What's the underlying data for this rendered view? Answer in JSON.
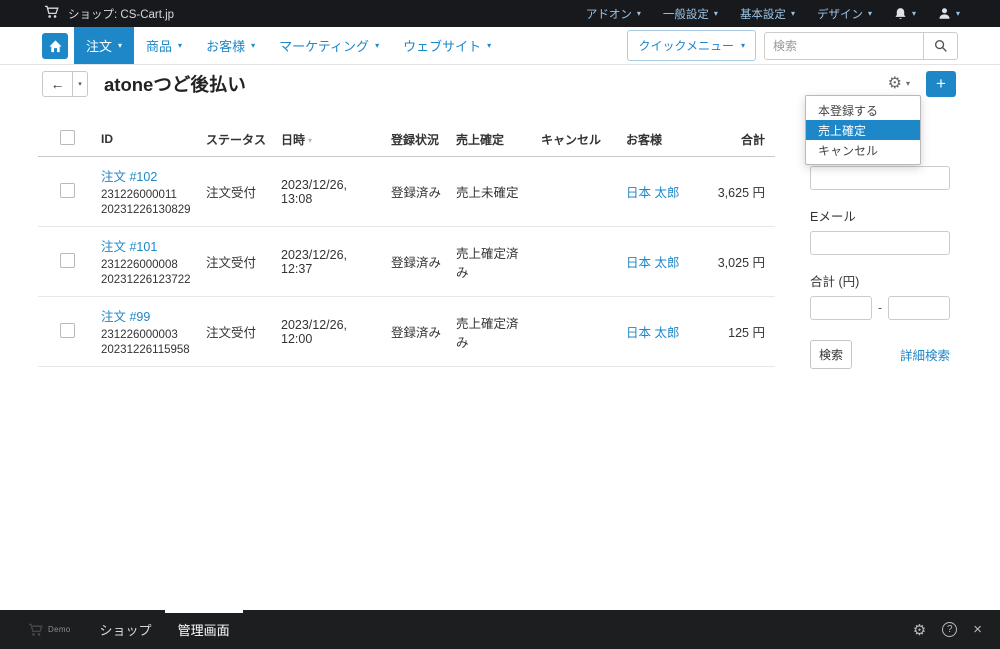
{
  "topbar": {
    "shop_label": "ショップ: CS-Cart.jp",
    "menus": [
      {
        "label": "アドオン"
      },
      {
        "label": "一般設定"
      },
      {
        "label": "基本設定"
      },
      {
        "label": "デザイン"
      }
    ]
  },
  "navbar": {
    "tabs": [
      {
        "label": "注文"
      },
      {
        "label": "商品"
      },
      {
        "label": "お客様"
      },
      {
        "label": "マーケティング"
      },
      {
        "label": "ウェブサイト"
      }
    ],
    "quick_menu_label": "クイックメニュー",
    "search_placeholder": "検索"
  },
  "header": {
    "title": "atoneつど後払い"
  },
  "gear_menu": {
    "items": [
      {
        "label": "本登録する"
      },
      {
        "label": "売上確定"
      },
      {
        "label": "キャンセル"
      }
    ]
  },
  "table": {
    "columns": [
      "ID",
      "ステータス",
      "日時",
      "登録状況",
      "売上確定",
      "キャンセル",
      "お客様",
      "合計"
    ],
    "rows": [
      {
        "order": "注文 #102",
        "id_line1": "231226000011",
        "id_line2": "20231226130829",
        "status": "注文受付",
        "datetime": "2023/12/26, 13:08",
        "registration": "登録済み",
        "sales": "売上未確定",
        "cancel": "",
        "customer": "日本 太郎",
        "total": "3,625 円"
      },
      {
        "order": "注文 #101",
        "id_line1": "231226000008",
        "id_line2": "20231226123722",
        "status": "注文受付",
        "datetime": "2023/12/26, 12:37",
        "registration": "登録済み",
        "sales": "売上確定済み",
        "cancel": "",
        "customer": "日本 太郎",
        "total": "3,025 円"
      },
      {
        "order": "注文 #99",
        "id_line1": "231226000003",
        "id_line2": "20231226115958",
        "status": "注文受付",
        "datetime": "2023/12/26, 12:00",
        "registration": "登録済み",
        "sales": "売上確定済み",
        "cancel": "",
        "customer": "日本 太郎",
        "total": "125 円"
      }
    ]
  },
  "sidebar": {
    "email_label": "Eメール",
    "total_label": "合計 (円)",
    "search_button": "検索",
    "advanced_search_link": "詳細検索"
  },
  "bottombar": {
    "demo_badge": "Demo",
    "shop_tab": "ショップ",
    "admin_tab": "管理画面"
  },
  "colors": {
    "accent": "#1e87c8"
  }
}
